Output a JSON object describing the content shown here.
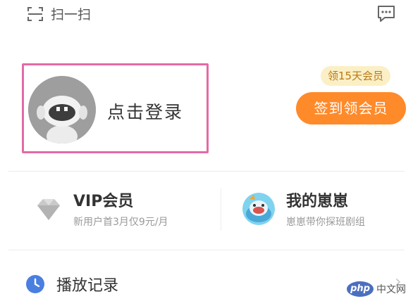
{
  "header": {
    "scan_label": "扫一扫",
    "scan_icon": "scan-icon",
    "message_icon": "message-icon"
  },
  "login": {
    "label": "点击登录",
    "avatar_icon": "default-avatar"
  },
  "promo": {
    "badge": "领15天会员",
    "button": "签到领会员",
    "button_color": "#ff8a2a",
    "highlight_color": "#e46aa5"
  },
  "cards": {
    "vip": {
      "title": "VIP会员",
      "subtitle": "新用户首3月仅9元/月",
      "icon": "diamond-icon"
    },
    "huihui": {
      "title": "我的崽崽",
      "subtitle": "崽崽带你探班剧组",
      "icon": "mascot-icon"
    }
  },
  "history": {
    "label": "播放记录",
    "icon": "clock-icon",
    "arrow": "chevron-right-icon"
  },
  "watermark": {
    "logo": "php",
    "text": "中文网"
  }
}
